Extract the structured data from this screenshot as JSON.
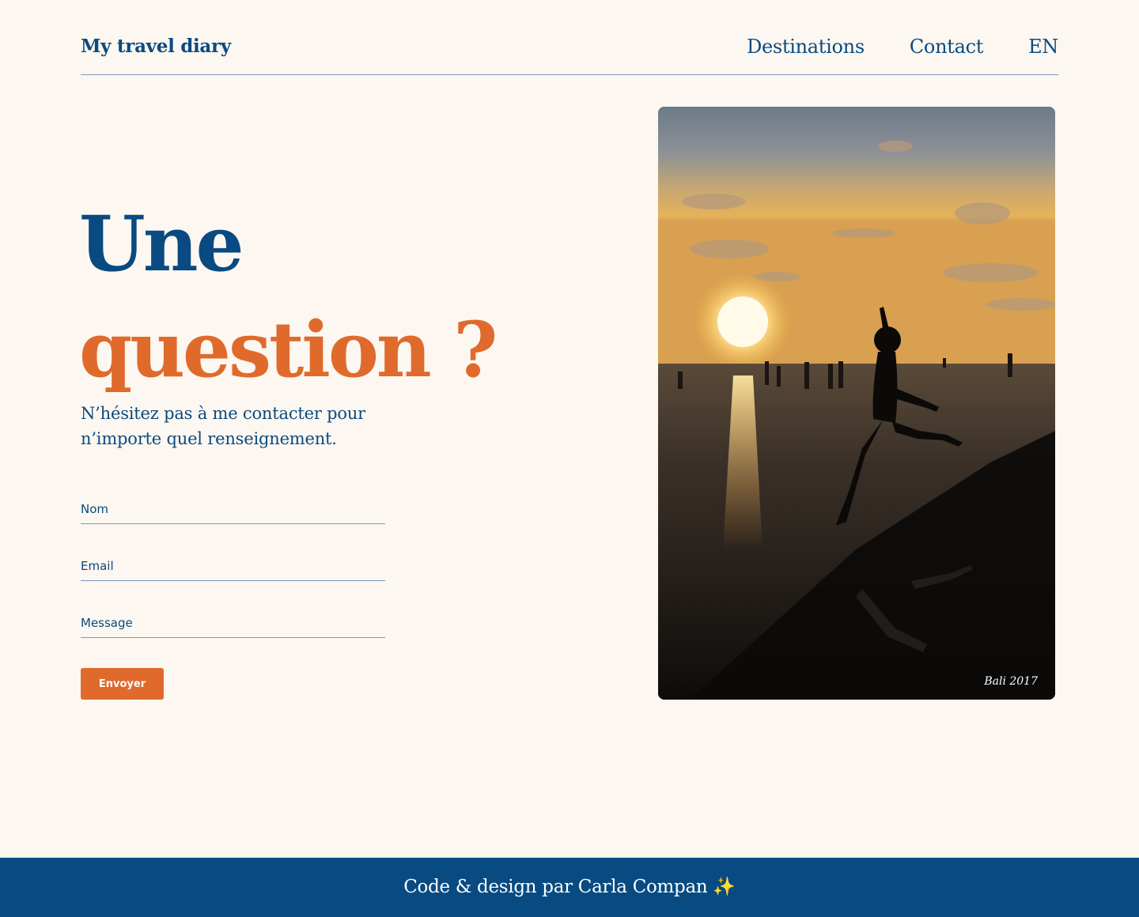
{
  "header": {
    "brand": "My travel diary",
    "nav": {
      "destinations": "Destinations",
      "contact": "Contact",
      "language": "EN"
    }
  },
  "hero": {
    "headline_line1": "Une",
    "headline_line2": "question ?",
    "subtitle": "N’hésitez pas à me contacter pour n’importe quel renseignement."
  },
  "form": {
    "name_placeholder": "Nom",
    "email_placeholder": "Email",
    "message_placeholder": "Message",
    "submit_label": "Envoyer"
  },
  "photo": {
    "caption": "Bali 2017"
  },
  "footer": {
    "credit": "Code & design par Carla Compan ✨"
  },
  "colors": {
    "background": "#fcf7f0",
    "primary_blue": "#0a4a82",
    "accent_orange": "#e06a2c",
    "footer_bg": "#084b82"
  }
}
